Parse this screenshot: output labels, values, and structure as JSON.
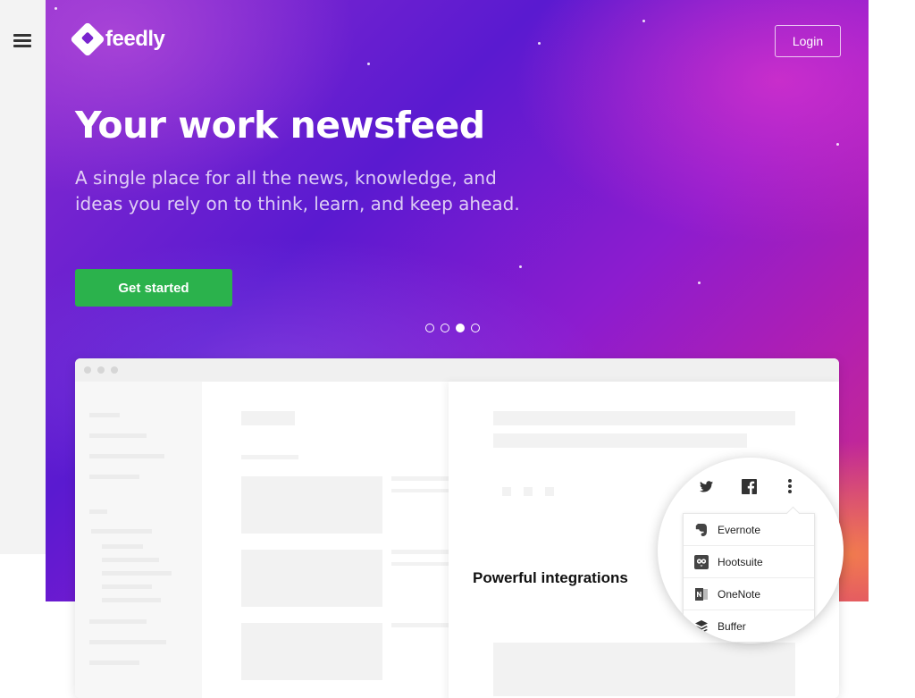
{
  "nav": {
    "menu_icon": "hamburger-icon"
  },
  "brand": {
    "name": "feedly",
    "logo_icon": "feedly-logo-icon"
  },
  "header": {
    "login_label": "Login"
  },
  "hero": {
    "headline": "Your work newsfeed",
    "subhead": "A single place for all the news, knowledge, and ideas you rely on to think, learn, and keep ahead.",
    "cta_label": "Get started",
    "carousel": {
      "slides": 4,
      "active_index": 3
    }
  },
  "preview": {
    "integrations_label": "Powerful integrations",
    "share_icons": [
      "twitter-icon",
      "facebook-icon",
      "more-vertical-icon"
    ],
    "integrations": [
      {
        "label": "Evernote",
        "icon": "evernote-icon"
      },
      {
        "label": "Hootsuite",
        "icon": "hootsuite-icon"
      },
      {
        "label": "OneNote",
        "icon": "onenote-icon"
      },
      {
        "label": "Buffer",
        "icon": "buffer-icon"
      }
    ]
  },
  "colors": {
    "hero_start": "#8a2bd0",
    "hero_end": "#d2317a",
    "cta_green": "#2bb24c",
    "login_border": "#ffffff"
  }
}
